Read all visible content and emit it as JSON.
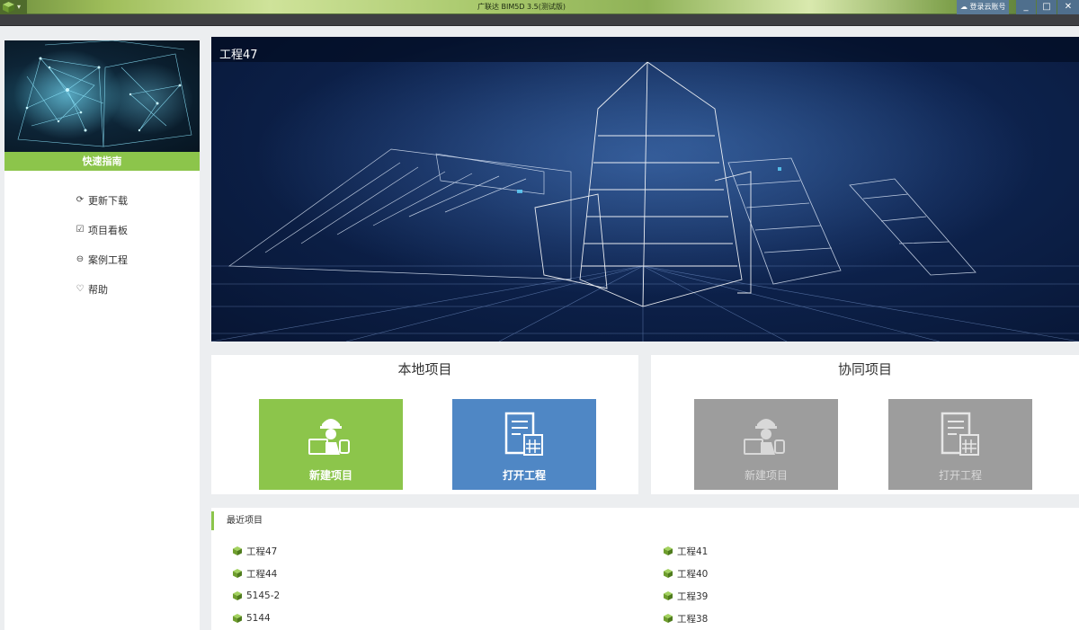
{
  "window": {
    "title": "广联达 BIM5D 3.5(测试版)",
    "cloud_login": "登录云账号",
    "minimize": "_",
    "maximize": "□",
    "close": "✕"
  },
  "sidebar": {
    "guide_label": "快速指南",
    "items": [
      {
        "label": "更新下载",
        "icon": "refresh-icon"
      },
      {
        "label": "项目看板",
        "icon": "board-icon"
      },
      {
        "label": "案例工程",
        "icon": "case-icon"
      },
      {
        "label": "帮助",
        "icon": "help-icon"
      }
    ]
  },
  "banner": {
    "title": "工程47"
  },
  "local_panel": {
    "title": "本地项目",
    "new_label": "新建项目",
    "open_label": "打开工程"
  },
  "collab_panel": {
    "title": "协同项目",
    "new_label": "新建项目",
    "open_label": "打开工程"
  },
  "recent": {
    "header": "最近项目",
    "left": [
      "工程47",
      "工程44",
      "5145-2",
      "5144"
    ],
    "right": [
      "工程41",
      "工程40",
      "工程39",
      "工程38"
    ]
  },
  "colors": {
    "accent_green": "#8cc54b",
    "accent_blue": "#4f87c5",
    "disabled_gray": "#9d9d9d"
  }
}
